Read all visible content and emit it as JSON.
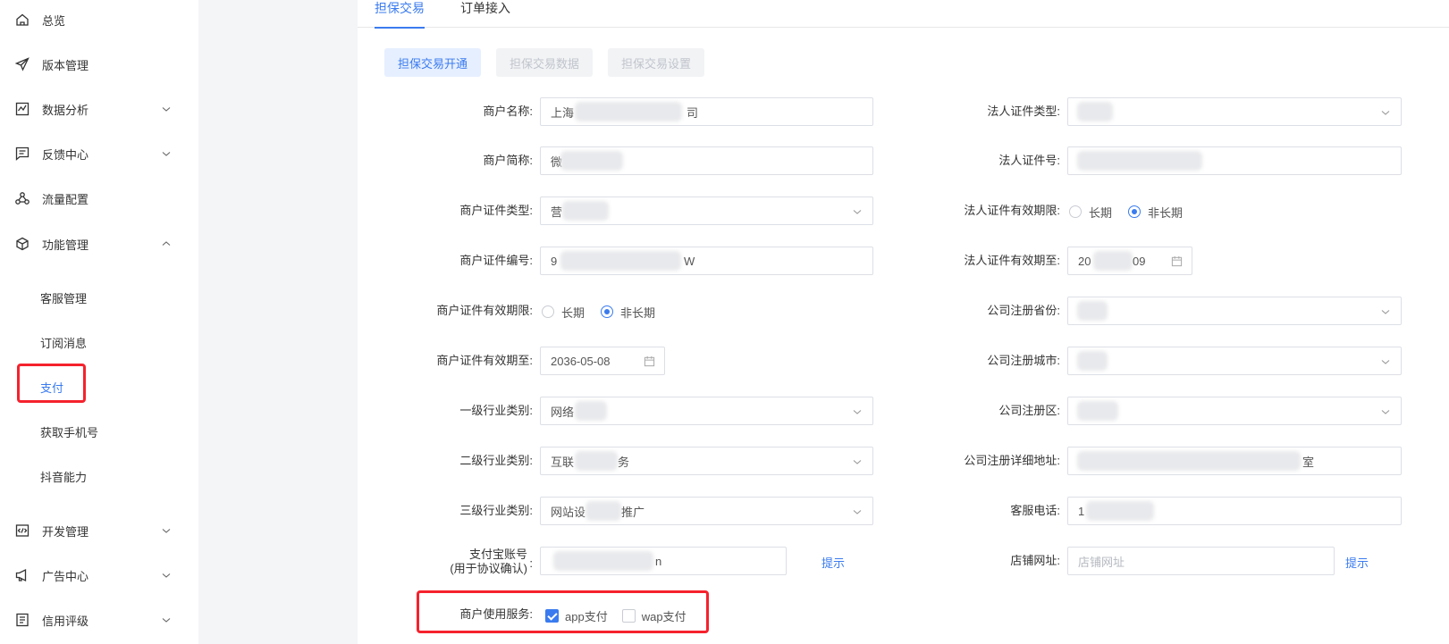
{
  "sidebar": {
    "items": [
      {
        "label": "总览"
      },
      {
        "label": "版本管理"
      },
      {
        "label": "数据分析"
      },
      {
        "label": "反馈中心"
      },
      {
        "label": "流量配置"
      },
      {
        "label": "功能管理"
      },
      {
        "label": "开发管理"
      },
      {
        "label": "广告中心"
      },
      {
        "label": "信用评级"
      }
    ],
    "sub_items": [
      {
        "label": "客服管理"
      },
      {
        "label": "订阅消息"
      },
      {
        "label": "支付",
        "active": true
      },
      {
        "label": "获取手机号"
      },
      {
        "label": "抖音能力"
      }
    ]
  },
  "tabs": [
    {
      "label": "担保交易",
      "active": true
    },
    {
      "label": "订单接入"
    }
  ],
  "subtabs": [
    {
      "label": "担保交易开通",
      "active": true
    },
    {
      "label": "担保交易数据",
      "disabled": true
    },
    {
      "label": "担保交易设置",
      "disabled": true
    }
  ],
  "form": {
    "merchant_name": {
      "label": "商户名称:",
      "value_start": "上海",
      "value_end": "司"
    },
    "merchant_short": {
      "label": "商户简称:",
      "value_start": "微"
    },
    "merchant_cert_type": {
      "label": "商户证件类型:",
      "value_start": "营"
    },
    "merchant_cert_no": {
      "label": "商户证件编号:",
      "value_start": "9",
      "value_end": "W"
    },
    "merchant_cert_term": {
      "label": "商户证件有效期限:",
      "options": [
        "长期",
        "非长期"
      ],
      "selected": "非长期"
    },
    "merchant_cert_expiry": {
      "label": "商户证件有效期至:",
      "value": "2036-05-08"
    },
    "industry_l1": {
      "label": "一级行业类别:",
      "value_start": "网络"
    },
    "industry_l2": {
      "label": "二级行业类别:",
      "value_start": "互联",
      "value_end": "务"
    },
    "industry_l3": {
      "label": "三级行业类别:",
      "value_start": "网站设",
      "value_end": "推广"
    },
    "alipay_account": {
      "label_line1": "支付宝账号",
      "label_line2": "(用于协议确认)",
      "label_colon": ":",
      "value_end": "n",
      "hint": "提示"
    },
    "services": {
      "label": "商户使用服务:",
      "options": [
        {
          "label": "app支付",
          "checked": true
        },
        {
          "label": "wap支付",
          "checked": false
        }
      ]
    },
    "legal_cert_type": {
      "label": "法人证件类型:"
    },
    "legal_cert_no": {
      "label": "法人证件号:"
    },
    "legal_cert_term": {
      "label": "法人证件有效期限:",
      "options": [
        "长期",
        "非长期"
      ],
      "selected": "非长期"
    },
    "legal_cert_expiry": {
      "label": "法人证件有效期至:",
      "value_start": "20",
      "value_end": "09"
    },
    "reg_province": {
      "label": "公司注册省份:"
    },
    "reg_city": {
      "label": "公司注册城市:"
    },
    "reg_district": {
      "label": "公司注册区:"
    },
    "reg_address": {
      "label": "公司注册详细地址:",
      "value_end": "室"
    },
    "service_phone": {
      "label": "客服电话:",
      "value_start": "1"
    },
    "shop_url": {
      "label": "店铺网址:",
      "placeholder": "店铺网址",
      "hint": "提示"
    }
  },
  "colors": {
    "accent": "#3a7bef",
    "highlight": "#f5222d"
  }
}
